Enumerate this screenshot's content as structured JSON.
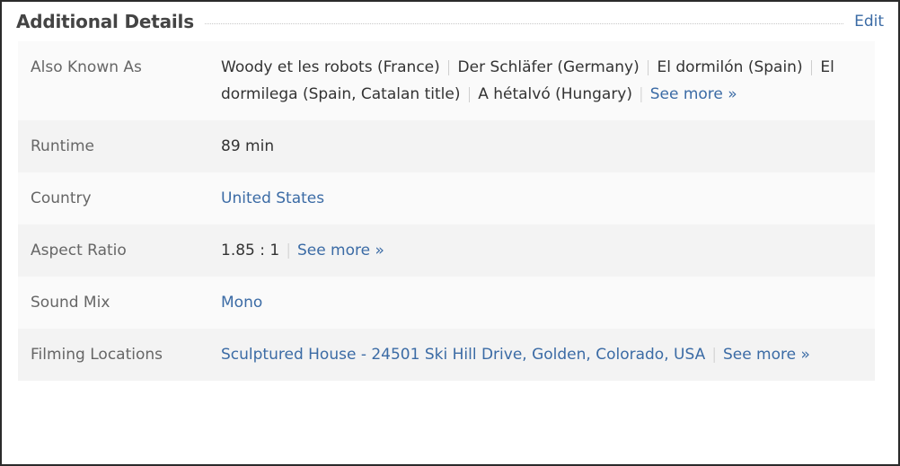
{
  "header": {
    "title": "Additional Details",
    "edit_label": "Edit",
    "rule": "dotted-divider"
  },
  "accent_color": "#3b6ba5",
  "label_color": "#666666",
  "value_color": "#333333",
  "separator": "|",
  "rows": [
    {
      "label": "Also Known As",
      "items": [
        {
          "text": "Woody et les robots (France)",
          "link": false
        },
        {
          "text": "Der Schläfer (Germany)",
          "link": false
        },
        {
          "text": "El dormilón (Spain)",
          "link": false
        },
        {
          "text": "El dormilega (Spain, Catalan title)",
          "link": false
        },
        {
          "text": "A hétalvó (Hungary)",
          "link": false
        },
        {
          "text": "See more »",
          "link": true
        }
      ]
    },
    {
      "label": "Runtime",
      "items": [
        {
          "text": "89 min",
          "link": false
        }
      ]
    },
    {
      "label": "Country",
      "items": [
        {
          "text": "United States",
          "link": true
        }
      ]
    },
    {
      "label": "Aspect Ratio",
      "items": [
        {
          "text": "1.85 : 1",
          "link": false
        },
        {
          "text": "See more »",
          "link": true
        }
      ]
    },
    {
      "label": "Sound Mix",
      "items": [
        {
          "text": "Mono",
          "link": true
        }
      ]
    },
    {
      "label": "Filming Locations",
      "items": [
        {
          "text": "Sculptured House - 24501 Ski Hill Drive, Golden, Colorado, USA",
          "link": true
        },
        {
          "text": "See more »",
          "link": true
        }
      ]
    }
  ]
}
